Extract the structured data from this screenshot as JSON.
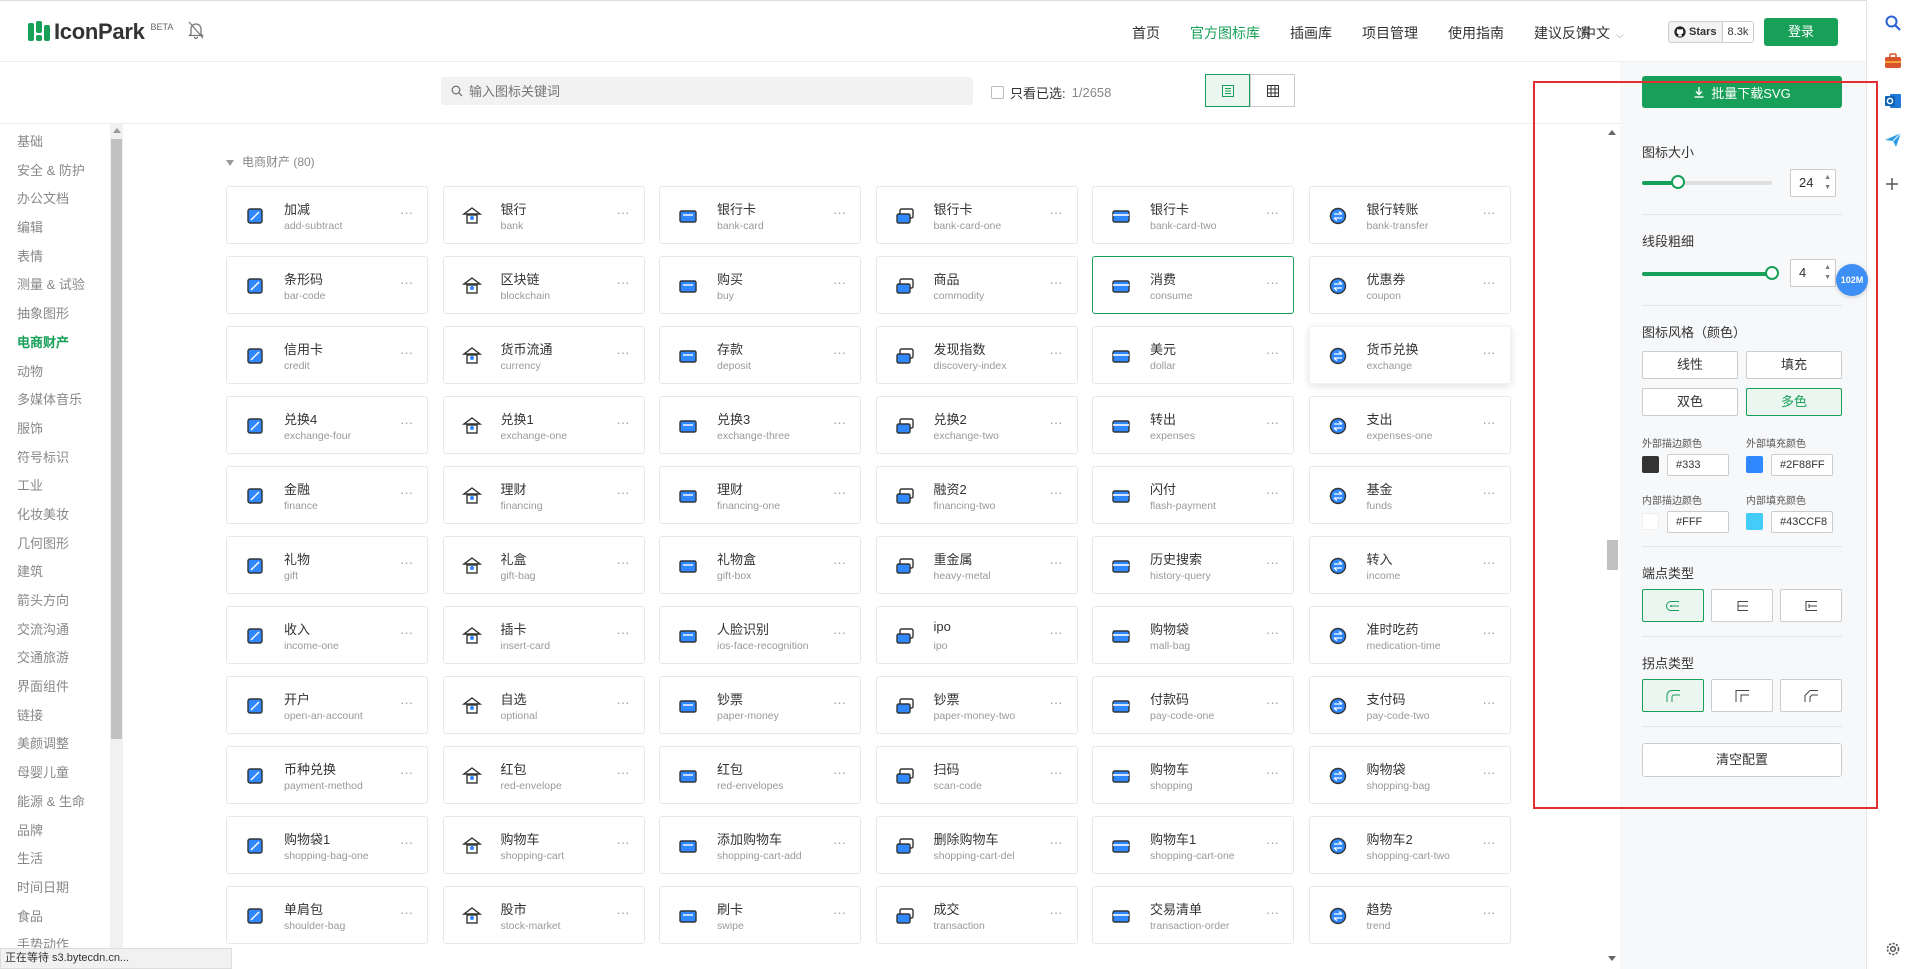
{
  "header": {
    "logo_text": "IconPark",
    "beta": "BETA",
    "nav": [
      "首页",
      "官方图标库",
      "插画库",
      "项目管理",
      "使用指南",
      "建议反馈"
    ],
    "active_nav": 1,
    "lang": "中文",
    "github_stars_label": "Stars",
    "github_stars_count": "8.3k",
    "login": "登录"
  },
  "toolbar": {
    "search_placeholder": "输入图标关键词",
    "only_selected_label": "只看已选:",
    "selected_count": "1/2658"
  },
  "sidebar": {
    "categories": [
      "基础",
      "安全 & 防护",
      "办公文档",
      "编辑",
      "表情",
      "测量 & 试验",
      "抽象图形",
      "电商财产",
      "动物",
      "多媒体音乐",
      "服饰",
      "符号标识",
      "工业",
      "化妆美妆",
      "几何图形",
      "建筑",
      "箭头方向",
      "交流沟通",
      "交通旅游",
      "界面组件",
      "链接",
      "美颜调整",
      "母婴儿童",
      "能源 & 生命",
      "品牌",
      "生活",
      "时间日期",
      "食品",
      "手势动作"
    ],
    "active_index": 7
  },
  "section": {
    "title": "电商财产 (80)"
  },
  "icons": [
    {
      "cn": "加减",
      "en": "add-subtract"
    },
    {
      "cn": "银行",
      "en": "bank"
    },
    {
      "cn": "银行卡",
      "en": "bank-card"
    },
    {
      "cn": "银行卡",
      "en": "bank-card-one"
    },
    {
      "cn": "银行卡",
      "en": "bank-card-two"
    },
    {
      "cn": "银行转账",
      "en": "bank-transfer"
    },
    {
      "cn": "条形码",
      "en": "bar-code"
    },
    {
      "cn": "区块链",
      "en": "blockchain"
    },
    {
      "cn": "购买",
      "en": "buy"
    },
    {
      "cn": "商品",
      "en": "commodity"
    },
    {
      "cn": "消费",
      "en": "consume"
    },
    {
      "cn": "优惠券",
      "en": "coupon"
    },
    {
      "cn": "信用卡",
      "en": "credit"
    },
    {
      "cn": "货币流通",
      "en": "currency"
    },
    {
      "cn": "存款",
      "en": "deposit"
    },
    {
      "cn": "发现指数",
      "en": "discovery-index"
    },
    {
      "cn": "美元",
      "en": "dollar"
    },
    {
      "cn": "货币兑换",
      "en": "exchange"
    },
    {
      "cn": "兑换4",
      "en": "exchange-four"
    },
    {
      "cn": "兑换1",
      "en": "exchange-one"
    },
    {
      "cn": "兑换3",
      "en": "exchange-three"
    },
    {
      "cn": "兑换2",
      "en": "exchange-two"
    },
    {
      "cn": "转出",
      "en": "expenses"
    },
    {
      "cn": "支出",
      "en": "expenses-one"
    },
    {
      "cn": "金融",
      "en": "finance"
    },
    {
      "cn": "理财",
      "en": "financing"
    },
    {
      "cn": "理财",
      "en": "financing-one"
    },
    {
      "cn": "融资2",
      "en": "financing-two"
    },
    {
      "cn": "闪付",
      "en": "flash-payment"
    },
    {
      "cn": "基金",
      "en": "funds"
    },
    {
      "cn": "礼物",
      "en": "gift"
    },
    {
      "cn": "礼盒",
      "en": "gift-bag"
    },
    {
      "cn": "礼物盒",
      "en": "gift-box"
    },
    {
      "cn": "重金属",
      "en": "heavy-metal"
    },
    {
      "cn": "历史搜索",
      "en": "history-query"
    },
    {
      "cn": "转入",
      "en": "income"
    },
    {
      "cn": "收入",
      "en": "income-one"
    },
    {
      "cn": "插卡",
      "en": "insert-card"
    },
    {
      "cn": "人脸识别",
      "en": "ios-face-recognition"
    },
    {
      "cn": "ipo",
      "en": "ipo"
    },
    {
      "cn": "购物袋",
      "en": "mall-bag"
    },
    {
      "cn": "准时吃药",
      "en": "medication-time"
    },
    {
      "cn": "开户",
      "en": "open-an-account"
    },
    {
      "cn": "自选",
      "en": "optional"
    },
    {
      "cn": "钞票",
      "en": "paper-money"
    },
    {
      "cn": "钞票",
      "en": "paper-money-two"
    },
    {
      "cn": "付款码",
      "en": "pay-code-one"
    },
    {
      "cn": "支付码",
      "en": "pay-code-two"
    },
    {
      "cn": "币种兑换",
      "en": "payment-method"
    },
    {
      "cn": "红包",
      "en": "red-envelope"
    },
    {
      "cn": "红包",
      "en": "red-envelopes"
    },
    {
      "cn": "扫码",
      "en": "scan-code"
    },
    {
      "cn": "购物车",
      "en": "shopping"
    },
    {
      "cn": "购物袋",
      "en": "shopping-bag"
    },
    {
      "cn": "购物袋1",
      "en": "shopping-bag-one"
    },
    {
      "cn": "购物车",
      "en": "shopping-cart"
    },
    {
      "cn": "添加购物车",
      "en": "shopping-cart-add"
    },
    {
      "cn": "删除购物车",
      "en": "shopping-cart-del"
    },
    {
      "cn": "购物车1",
      "en": "shopping-cart-one"
    },
    {
      "cn": "购物车2",
      "en": "shopping-cart-two"
    },
    {
      "cn": "单肩包",
      "en": "shoulder-bag"
    },
    {
      "cn": "股市",
      "en": "stock-market"
    },
    {
      "cn": "刷卡",
      "en": "swipe"
    },
    {
      "cn": "成交",
      "en": "transaction"
    },
    {
      "cn": "交易清单",
      "en": "transaction-order"
    },
    {
      "cn": "趋势",
      "en": "trend"
    }
  ],
  "selected_icon": "consume",
  "hovered_icon": "exchange",
  "panel": {
    "download_btn": "批量下载SVG",
    "size_label": "图标大小",
    "size_value": "24",
    "size_fraction": 0.28,
    "stroke_label": "线段粗细",
    "stroke_value": "4",
    "stroke_fraction": 1.0,
    "style_label": "图标风格（颜色）",
    "styles": [
      "线性",
      "填充",
      "双色",
      "多色"
    ],
    "active_style": "多色",
    "outer_stroke_label": "外部描边颜色",
    "outer_stroke_color": "#333",
    "outer_fill_label": "外部填充颜色",
    "outer_fill_color": "#2F88FF",
    "inner_stroke_label": "内部描边颜色",
    "inner_stroke_color": "#FFF",
    "inner_fill_label": "内部填充颜色",
    "inner_fill_color": "#43CCF8",
    "endpoint_label": "端点类型",
    "corner_label": "拐点类型",
    "clear_btn": "清空配置"
  },
  "memory_badge": "102M",
  "status_text": "正在等待 s3.bytecdn.cn...",
  "colors": {
    "brand": "#18a058",
    "icon_blue": "#2F88FF",
    "icon_cyan": "#43CCF8",
    "highlight_border": "#e23030"
  }
}
